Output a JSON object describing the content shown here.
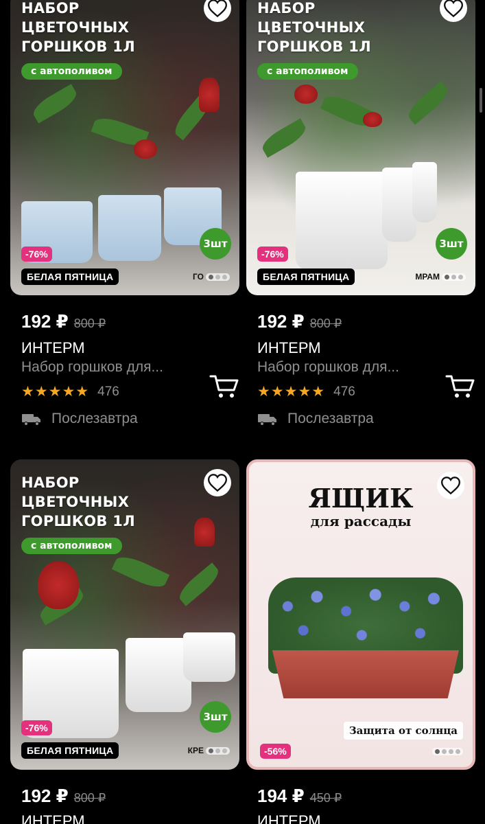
{
  "products": [
    {
      "promo_title": "НАБОР ЦВЕТОЧНЫХ ГОРШКОВ 1л",
      "promo_pill": "с автополивом",
      "qty_badge": "3шт",
      "discount": "-76%",
      "sale_tag": "БЕЛАЯ ПЯТНИЦА",
      "material": "ГО",
      "price": "192 ₽",
      "old_price": "800 ₽",
      "brand": "ИНТЕРМ",
      "description": "Набор горшков для...",
      "stars": "★★★★★",
      "reviews": "476",
      "delivery": "Послезавтра"
    },
    {
      "promo_title": "НАБОР ЦВЕТОЧНЫХ ГОРШКОВ 1л",
      "promo_pill": "с автополивом",
      "qty_badge": "3шт",
      "discount": "-76%",
      "sale_tag": "БЕЛАЯ ПЯТНИЦА",
      "material": "МРАМ",
      "price": "192 ₽",
      "old_price": "800 ₽",
      "brand": "ИНТЕРМ",
      "description": "Набор горшков для...",
      "stars": "★★★★★",
      "reviews": "476",
      "delivery": "Послезавтра"
    },
    {
      "promo_title": "НАБОР ЦВЕТОЧНЫХ ГОРШКОВ 1л",
      "promo_pill": "с автополивом",
      "qty_badge": "3шт",
      "discount": "-76%",
      "sale_tag": "БЕЛАЯ ПЯТНИЦА",
      "material": "КРЕ",
      "price": "192 ₽",
      "old_price": "800 ₽",
      "brand": "ИНТЕРМ"
    },
    {
      "box_title": "ЯЩИК",
      "box_subtitle": "для рассады",
      "box_caption": "Защита от солнца",
      "discount": "-56%",
      "price": "194 ₽",
      "old_price": "450 ₽",
      "brand": "ИНТЕРМ"
    }
  ],
  "icons": {
    "favorite": "heart-icon",
    "cart": "cart-icon",
    "delivery": "truck-icon"
  },
  "colors": {
    "background": "#000000",
    "promo_green": "#3e9a2c",
    "discount_pink": "#e3317d",
    "star_orange": "#f5a623",
    "muted_text": "#8f8f8f"
  }
}
